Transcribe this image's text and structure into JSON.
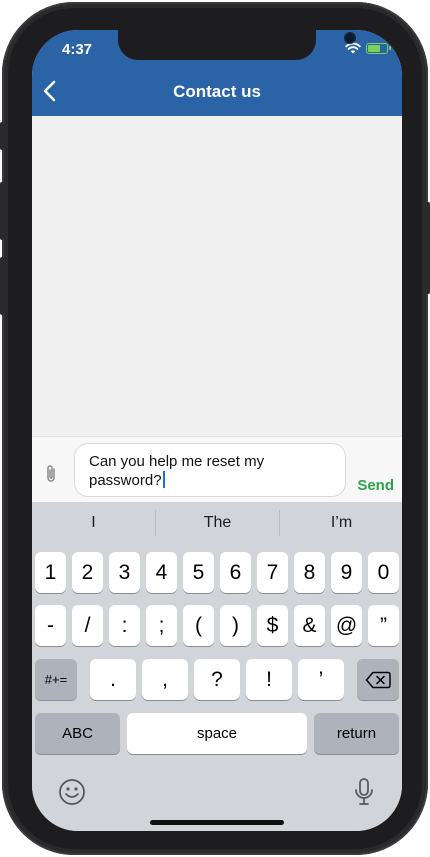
{
  "status_bar": {
    "time": "4:37",
    "battery_level": 0.7,
    "battery_color": "#7bd35d"
  },
  "header": {
    "title": "Contact us",
    "background": "#2a63a6",
    "back_icon": "chevron-left-icon"
  },
  "composer": {
    "attach_icon": "paperclip-icon",
    "message_line1": "Can you help me reset my",
    "message_line2": "password?",
    "send_label": "Send",
    "send_color": "#2ea44f"
  },
  "keyboard": {
    "suggestions": [
      "I",
      "The",
      "I’m"
    ],
    "row1": [
      "1",
      "2",
      "3",
      "4",
      "5",
      "6",
      "7",
      "8",
      "9",
      "0"
    ],
    "row2": [
      "-",
      "/",
      ":",
      ";",
      "(",
      ")",
      "$",
      "&",
      "@",
      "”"
    ],
    "row3_mode": "#+=",
    "row3": [
      ".",
      ",",
      "?",
      "!",
      "’"
    ],
    "delete_icon": "backspace-icon",
    "abc_label": "ABC",
    "space_label": "space",
    "return_label": "return",
    "emoji_icon": "emoji-icon",
    "mic_icon": "microphone-icon"
  }
}
